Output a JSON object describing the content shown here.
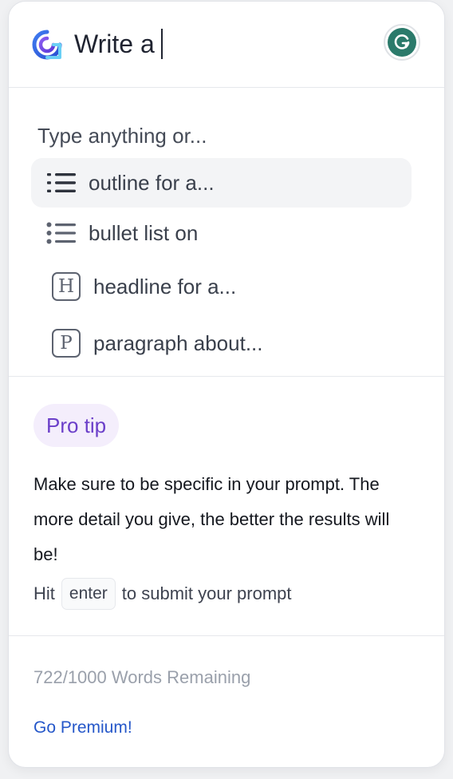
{
  "header": {
    "prompt_value": "Write a",
    "logo_icon": "writer-logo-icon",
    "avatar_icon": "grammarly-g-icon",
    "avatar_letter": "G",
    "avatar_color": "#2b7a6b"
  },
  "suggestions": {
    "heading": "Type anything or...",
    "items": [
      {
        "label": "outline for a...",
        "icon": "outline-list-icon",
        "active": true
      },
      {
        "label": "bullet list on",
        "icon": "bullet-list-icon",
        "active": false
      },
      {
        "label": "headline for a...",
        "icon": "headline-h-icon",
        "icon_letter": "H",
        "active": false
      },
      {
        "label": "paragraph about...",
        "icon": "paragraph-p-icon",
        "icon_letter": "P",
        "active": false
      }
    ]
  },
  "tip": {
    "badge": "Pro tip",
    "text": "Make sure to be specific in your prompt. The more detail you give, the better the results will be!",
    "enter_prefix": "Hit",
    "enter_key": "enter",
    "enter_suffix": "to submit your prompt"
  },
  "footer": {
    "words_remaining": "722/1000 Words Remaining",
    "premium_link": "Go Premium!"
  },
  "colors": {
    "accent_purple": "#6b3fc9",
    "badge_bg": "#f4eefc",
    "link_blue": "#2557c9",
    "muted_text": "#9aa0ab"
  }
}
